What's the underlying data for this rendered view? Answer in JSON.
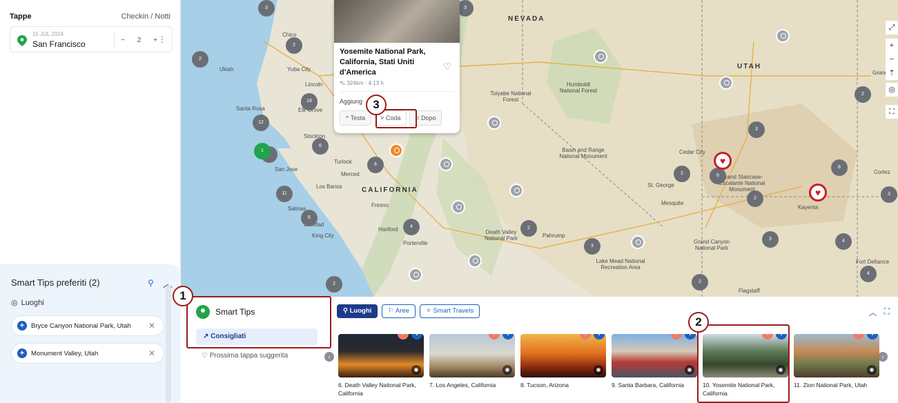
{
  "tappe": {
    "title": "Tappe",
    "checkin_label": "Checkin / Notti",
    "stop": {
      "date": "15 JUL 2024",
      "city": "San Francisco",
      "nights": "2",
      "minus": "−",
      "plus": "+"
    }
  },
  "favorites": {
    "title": "Smart Tips preferiti (2)",
    "section": "Luoghi",
    "items": [
      "Bryce Canyon National Park, Utah",
      "Monument Valley, Utah"
    ]
  },
  "popup": {
    "title": "Yosemite National Park, California, Stati Uniti d'America",
    "distance": "324km - 4:13 h",
    "add_label": "Aggiung",
    "buttons": {
      "testa": "Testa",
      "coda": "Coda",
      "dopo": "Dopo"
    }
  },
  "map_labels": {
    "states": {
      "nevada": "NEVADA",
      "utah": "UTAH",
      "california": "CALIFORNIA"
    },
    "places": {
      "chico": "Chico",
      "ukiah": "Ukiah",
      "yuba": "Yuba City",
      "lincoln": "Lincoln",
      "santa_rosa": "Santa Rosa",
      "elk_grove": "Elk Grove",
      "stockton": "Stockton",
      "turlock": "Turlock",
      "merced": "Merced",
      "san_jose": "San Jose",
      "los_banos": "Los Banos",
      "fresno": "Fresno",
      "salinas": "Salinas",
      "soledad": "Soledad",
      "king_city": "King City",
      "hanford": "Hanford",
      "porterville": "Porterville",
      "toiyabe": "Toiyabe National Forest",
      "humboldt": "Humboldt National Forest",
      "basin": "Basin and Range National Monument",
      "death_valley": "Death Valley National Park",
      "pahrump": "Pahrump",
      "lake_mead": "Lake Mead National Recreation Area",
      "mesquite": "Mesquite",
      "st_george": "St. George",
      "cedar_city": "Cedar City",
      "grand_staircase": "Grand Staircase-Escalante National Monument",
      "grand_canyon": "Grand Canyon National Park",
      "kayenta": "Kayenta",
      "flagstaff": "Flagstaff",
      "fort_defiance": "Fort Defiance",
      "cortez": "Cortez",
      "grand": "Grand"
    },
    "clusters": [
      "2",
      "2",
      "2",
      "6",
      "12",
      "2",
      "6",
      "11",
      "18",
      "6",
      "4",
      "2",
      "2",
      "3",
      "2",
      "6",
      "3",
      "2",
      "8",
      "2",
      "3",
      "4",
      "2",
      "4",
      "3",
      "3",
      "3"
    ],
    "green_pin": "1"
  },
  "smart_tips": {
    "title": "Smart Tips",
    "consigliati": "Consigliati",
    "prossima": "Prossima tappa suggerita",
    "tabs": [
      "Luoghi",
      "Aree",
      "Smart Travels"
    ]
  },
  "cards": [
    {
      "label": "6. Death Valley National Park, California"
    },
    {
      "label": "7. Los Angeles, California"
    },
    {
      "label": "8. Tucson, Arizona"
    },
    {
      "label": "9. Santa Barbara, California"
    },
    {
      "label": "10. Yosemite National Park, California"
    },
    {
      "label": "11. Zion National Park, Utah"
    }
  ],
  "annotations": [
    "1",
    "2",
    "3"
  ],
  "colors": {
    "accent": "#1e5fbf",
    "annotation": "#9b1b1b",
    "green": "#22a34a",
    "heart": "#c81e2b"
  }
}
